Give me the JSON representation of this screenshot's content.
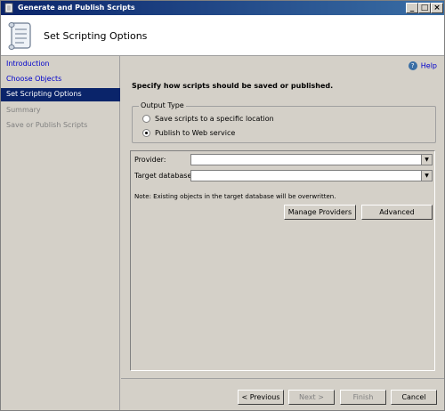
{
  "window": {
    "title": "Generate and Publish Scripts",
    "minimize": "_",
    "maximize": "□",
    "close": "×"
  },
  "header": {
    "title": "Set Scripting Options"
  },
  "sidebar": {
    "items": [
      {
        "label": "Introduction",
        "state": "link"
      },
      {
        "label": "Choose Objects",
        "state": "link"
      },
      {
        "label": "Set Scripting Options",
        "state": "active"
      },
      {
        "label": "Summary",
        "state": "disabled"
      },
      {
        "label": "Save or Publish Scripts",
        "state": "disabled"
      }
    ]
  },
  "main": {
    "help_label": "Help",
    "instruction": "Specify how scripts should be saved or published.",
    "output_type": {
      "legend": "Output Type",
      "options": [
        {
          "label": "Save scripts to a specific location",
          "selected": false
        },
        {
          "label": "Publish to Web service",
          "selected": true
        }
      ]
    },
    "provider": {
      "label": "Provider:",
      "value": ""
    },
    "target_database": {
      "label": "Target database:",
      "value": ""
    },
    "note": "Note: Existing objects in the target database will be overwritten.",
    "manage_providers_label": "Manage Providers",
    "advanced_label": "Advanced"
  },
  "footer": {
    "previous_label": "< Previous",
    "next_label": "Next >",
    "finish_label": "Finish",
    "cancel_label": "Cancel"
  },
  "colors": {
    "titlebar": "#0a246a",
    "selected_nav": "#0a246a",
    "link": "#0000cc"
  }
}
